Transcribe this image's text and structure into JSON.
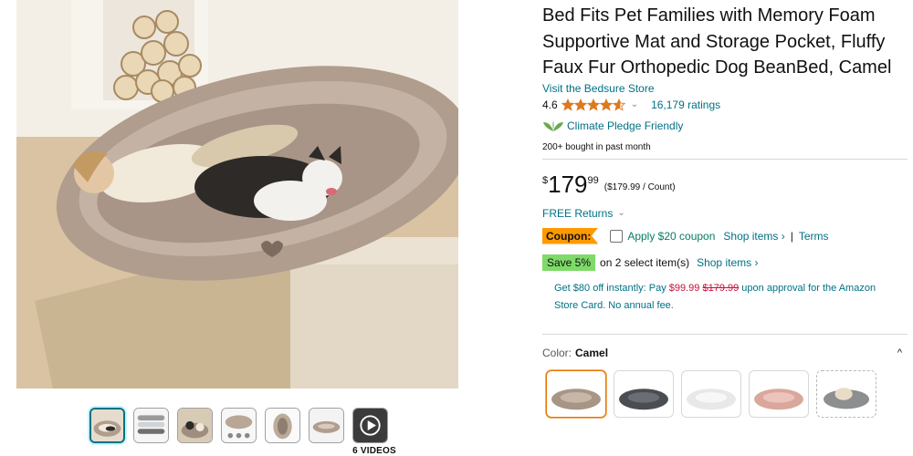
{
  "product": {
    "title": "Bed Fits Pet Families with Memory Foam Supportive Mat and Storage Pocket, Fluffy Faux Fur Orthopedic Dog BeanBed, Camel",
    "store_link": "Visit the Bedsure Store",
    "rating_value": "4.6",
    "rating_stars": 4.6,
    "rating_chevron": "⌄",
    "ratings_count": "16,179 ratings",
    "climate_pledge": "Climate Pledge Friendly",
    "bought_text": "200+ bought in past month"
  },
  "price": {
    "currency": "$",
    "whole": "179",
    "fraction": "99",
    "unit_price": "($179.99 / Count)"
  },
  "returns": {
    "label": "FREE Returns",
    "chevron": "⌄"
  },
  "coupon": {
    "tag": "Coupon:",
    "apply_text": "Apply $20 coupon",
    "shop_items": "Shop items ›",
    "separator": "|",
    "terms": "Terms"
  },
  "save": {
    "badge": "Save 5%",
    "text": "on 2 select item(s)",
    "shop_items": "Shop items ›"
  },
  "card_offer": {
    "prefix": "Get $80 off instantly: Pay ",
    "new_price": "$99.99",
    "space": " ",
    "old_price": "$179.99",
    "suffix": " upon approval for the Amazon Store Card. No annual fee."
  },
  "color": {
    "label": "Color:",
    "value": "Camel",
    "caret": "^",
    "swatch_names": [
      "Camel",
      "Dark Grey",
      "White",
      "Pink",
      "Grey Pattern"
    ]
  },
  "gallery": {
    "video_count": "6 VIDEOS",
    "thumb_count": 7
  },
  "colors": {
    "link": "#007185",
    "coupon_tag": "#ff9900",
    "save_badge": "#7fda69",
    "deal_red": "#cc0c39",
    "star": "#de7921",
    "selected_border": "#e77600"
  }
}
